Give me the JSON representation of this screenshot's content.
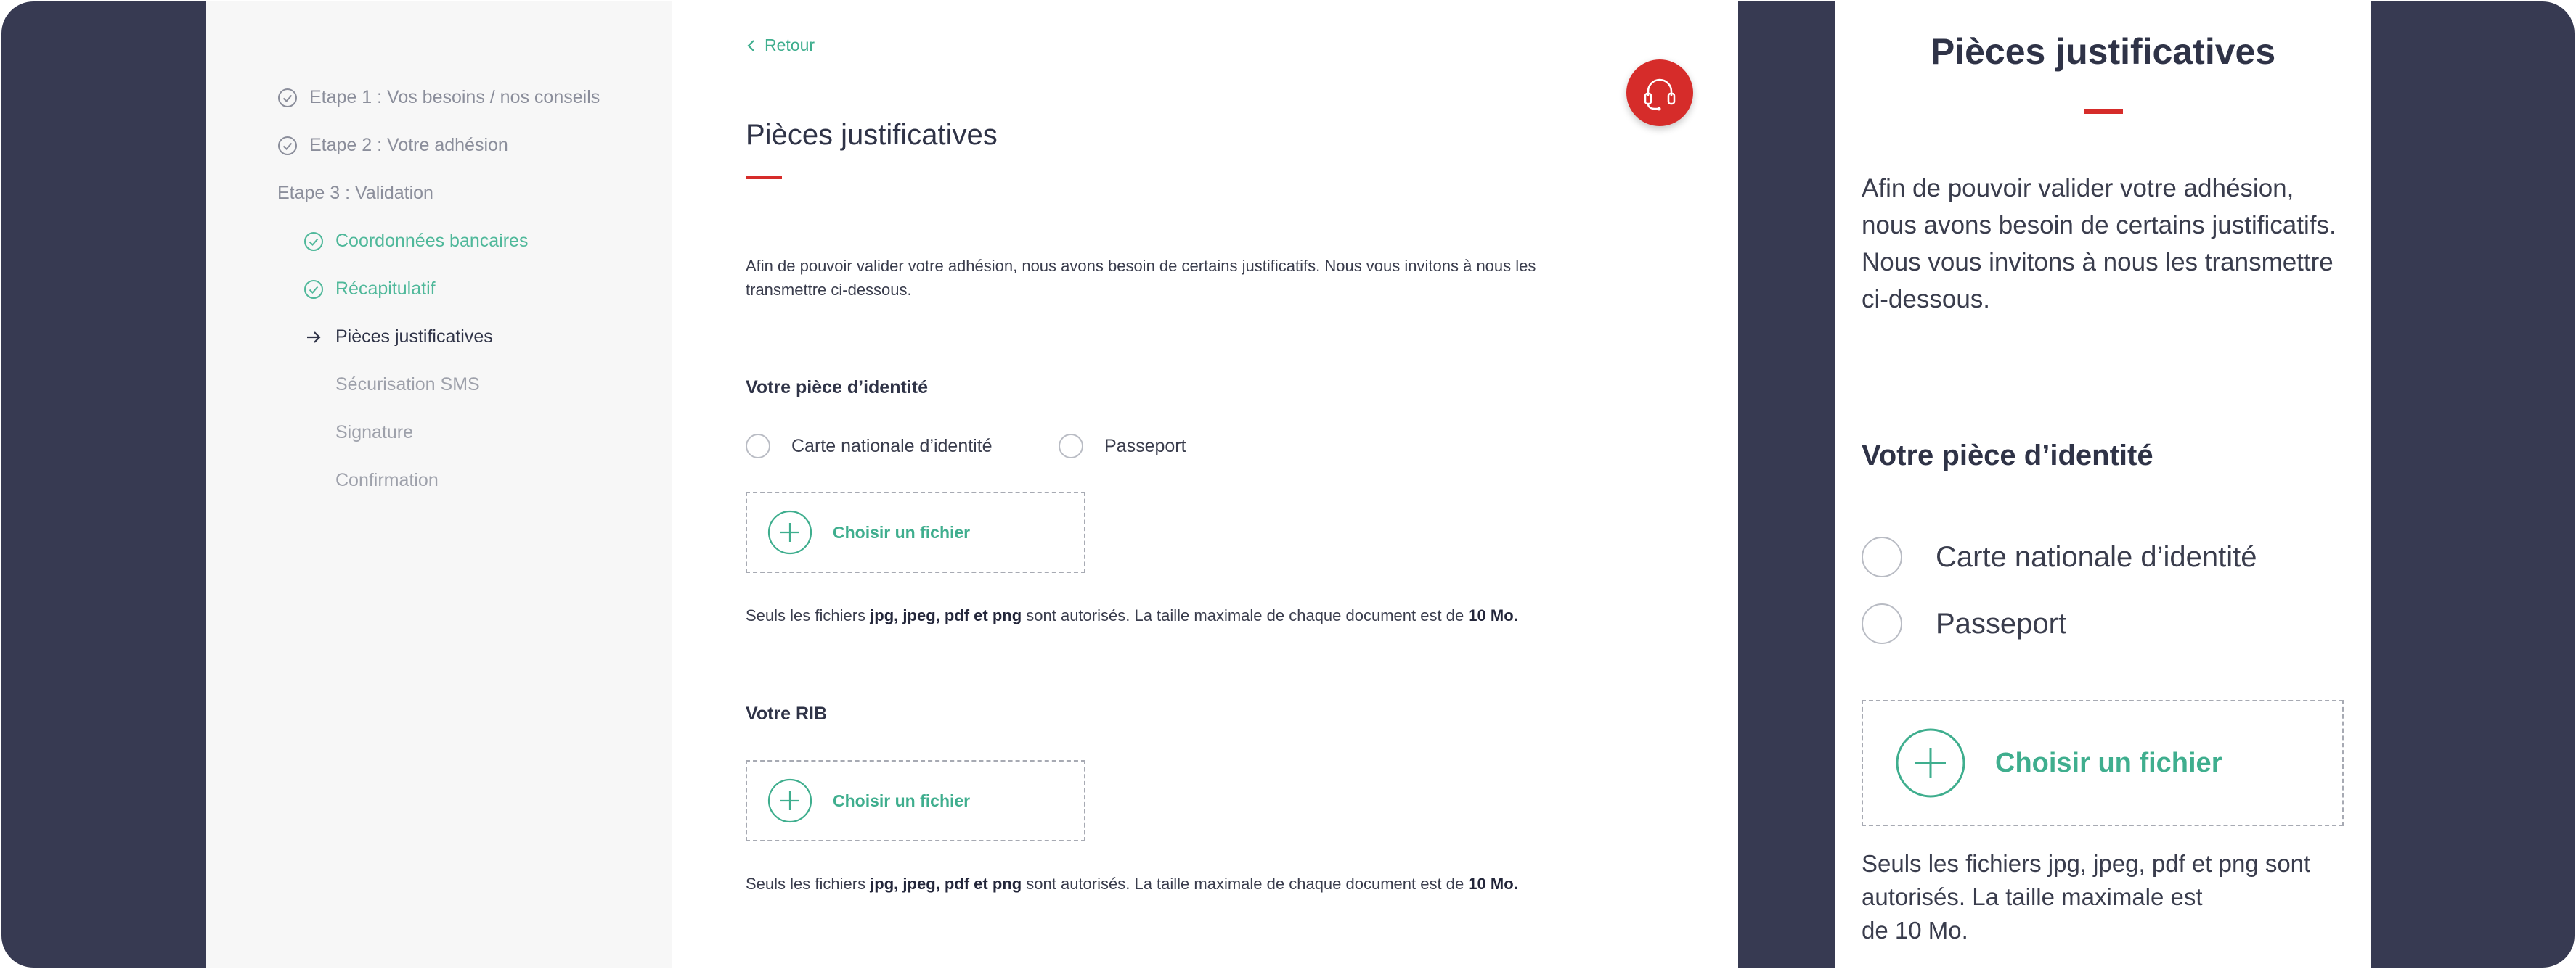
{
  "sidebar": {
    "steps": [
      {
        "label": "Etape 1 : Vos besoins / nos conseils",
        "state": "done"
      },
      {
        "label": "Etape 2 : Votre adhésion",
        "state": "done"
      },
      {
        "label": "Etape 3 : Validation",
        "state": "header"
      },
      {
        "label": "Coordonnées bancaires",
        "state": "done-sub"
      },
      {
        "label": "Récapitulatif",
        "state": "done-sub"
      },
      {
        "label": "Pièces justificatives",
        "state": "current"
      },
      {
        "label": "Sécurisation SMS",
        "state": "todo"
      },
      {
        "label": "Signature",
        "state": "todo"
      },
      {
        "label": "Confirmation",
        "state": "todo"
      }
    ]
  },
  "main": {
    "back_label": "Retour",
    "support_icon": "headset-icon",
    "title": "Pièces justificatives",
    "intro": "Afin de pouvoir valider votre adhésion, nous avons besoin de certains justificatifs. Nous vous invitons à nous les transmettre ci-dessous.",
    "identity": {
      "label": "Votre pièce d’identité",
      "options": [
        "Carte nationale d’identité",
        "Passeport"
      ],
      "upload_label": "Choisir un fichier"
    },
    "rib": {
      "label": "Votre RIB",
      "upload_label": "Choisir un fichier"
    },
    "hint": {
      "prefix": "Seuls les fichiers ",
      "formats": "jpg, jpeg, pdf et png",
      "middle": " sont autorisés. La taille maximale de chaque document est de ",
      "size": "10 Mo."
    }
  },
  "mobile": {
    "title": "Pièces justificatives",
    "intro": "Afin de pouvoir valider votre adhésion, nous avons besoin de certains justificatifs. Nous vous invitons à nous les transmettre ci-dessous.",
    "identity_label": "Votre pièce d’identité",
    "options": [
      "Carte nationale d’identité",
      "Passeport"
    ],
    "upload_label": "Choisir un fichier",
    "hint_lines": [
      "Seuls les fichiers jpg, jpeg, pdf et png sont",
      "autorisés. La taille maximale est",
      "de 10 Mo."
    ]
  },
  "colors": {
    "frame": "#373a52",
    "accent_green": "#3fae8e",
    "accent_red": "#d62c2a",
    "text_dark": "#2f3347"
  }
}
